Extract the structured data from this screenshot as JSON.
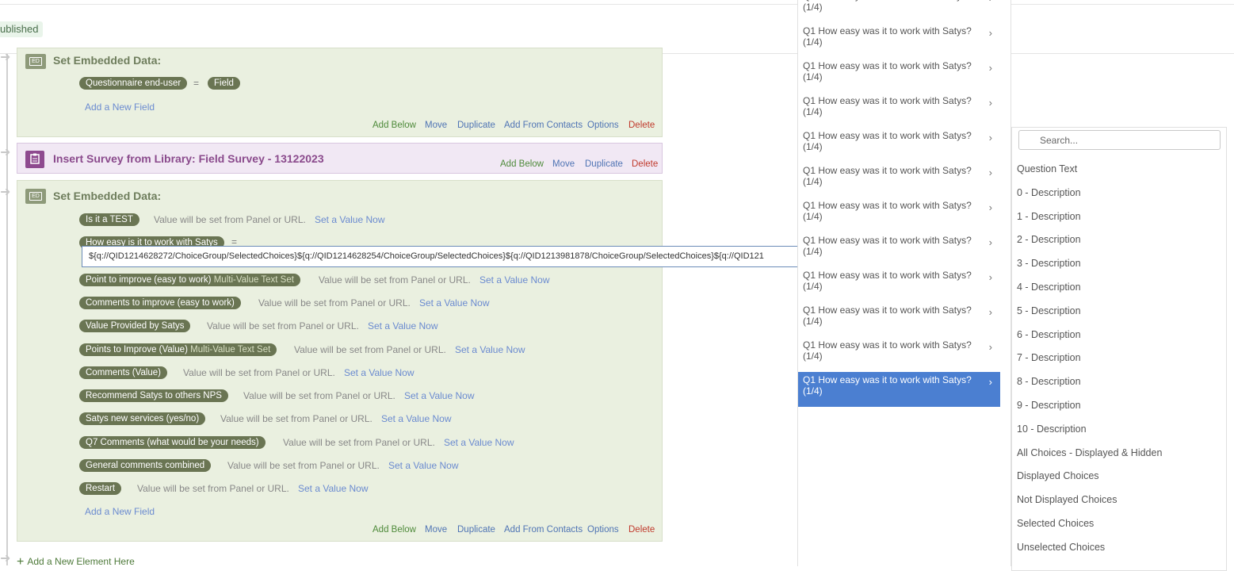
{
  "header": {
    "status": "ublished"
  },
  "block1": {
    "title": "Set Embedded Data:",
    "field_name": "Questionnaire end-user",
    "equals": "=",
    "field_value": "Field",
    "add_field": "Add a New Field",
    "actions": [
      "Add Below",
      "Move",
      "Duplicate",
      "Add From Contacts",
      "Options",
      "Delete"
    ]
  },
  "block2": {
    "title": "Insert Survey from Library: Field Survey - 13122023",
    "actions": [
      "Add Below",
      "Move",
      "Duplicate",
      "Delete"
    ]
  },
  "block3": {
    "title": "Set Embedded Data:",
    "equals": "=",
    "note": "Value will be set from Panel or URL.",
    "set_value": "Set a Value Now",
    "rows": [
      {
        "name": "Is it a TEST",
        "mv": ""
      },
      {
        "name": "How easy is it to work with Satys",
        "mv": ""
      },
      {
        "name": "Point to improve (easy to work)",
        "mv": "Multi-Value Text Set"
      },
      {
        "name": "Comments to improve (easy to work)",
        "mv": ""
      },
      {
        "name": "Value Provided by Satys",
        "mv": ""
      },
      {
        "name": "Points to Improve (Value)",
        "mv": "Multi-Value Text Set"
      },
      {
        "name": "Comments (Value)",
        "mv": ""
      },
      {
        "name": "Recommend Satys to others NPS",
        "mv": ""
      },
      {
        "name": "Satys new services (yes/no)",
        "mv": ""
      },
      {
        "name": "Q7 Comments (what would be your needs)",
        "mv": ""
      },
      {
        "name": "General comments combined",
        "mv": ""
      },
      {
        "name": "Restart",
        "mv": ""
      }
    ],
    "add_field": "Add a New Field",
    "actions": [
      "Add Below",
      "Move",
      "Duplicate",
      "Add From Contacts",
      "Options",
      "Delete"
    ]
  },
  "value_input": "${q://QID1214628272/ChoiceGroup/SelectedChoices}${q://QID1214628254/ChoiceGroup/SelectedChoices}${q://QID1213981878/ChoiceGroup/SelectedChoices}${q://QID121",
  "add_element": "Add a New Element Here",
  "question_menu": {
    "item_line1": "Q1 How easy was it to work with Satys?",
    "item_line2": "(1/4)",
    "count": 12,
    "active_index": 11
  },
  "piped_menu": {
    "search_placeholder": "Search...",
    "items": [
      "Question Text",
      "0 - Description",
      "1 - Description",
      "2 - Description",
      "3 - Description",
      "4 - Description",
      "5 - Description",
      "6 - Description",
      "7 - Description",
      "8 - Description",
      "9 - Description",
      "10 - Description",
      "All Choices - Displayed & Hidden",
      "Displayed Choices",
      "Not Displayed Choices",
      "Selected Choices",
      "Unselected Choices"
    ]
  },
  "colors": {
    "accent": "#4b7fd1",
    "pill": "#6a7553",
    "block_bg": "#eaf0e0",
    "library_bg": "#f1e8f4"
  }
}
